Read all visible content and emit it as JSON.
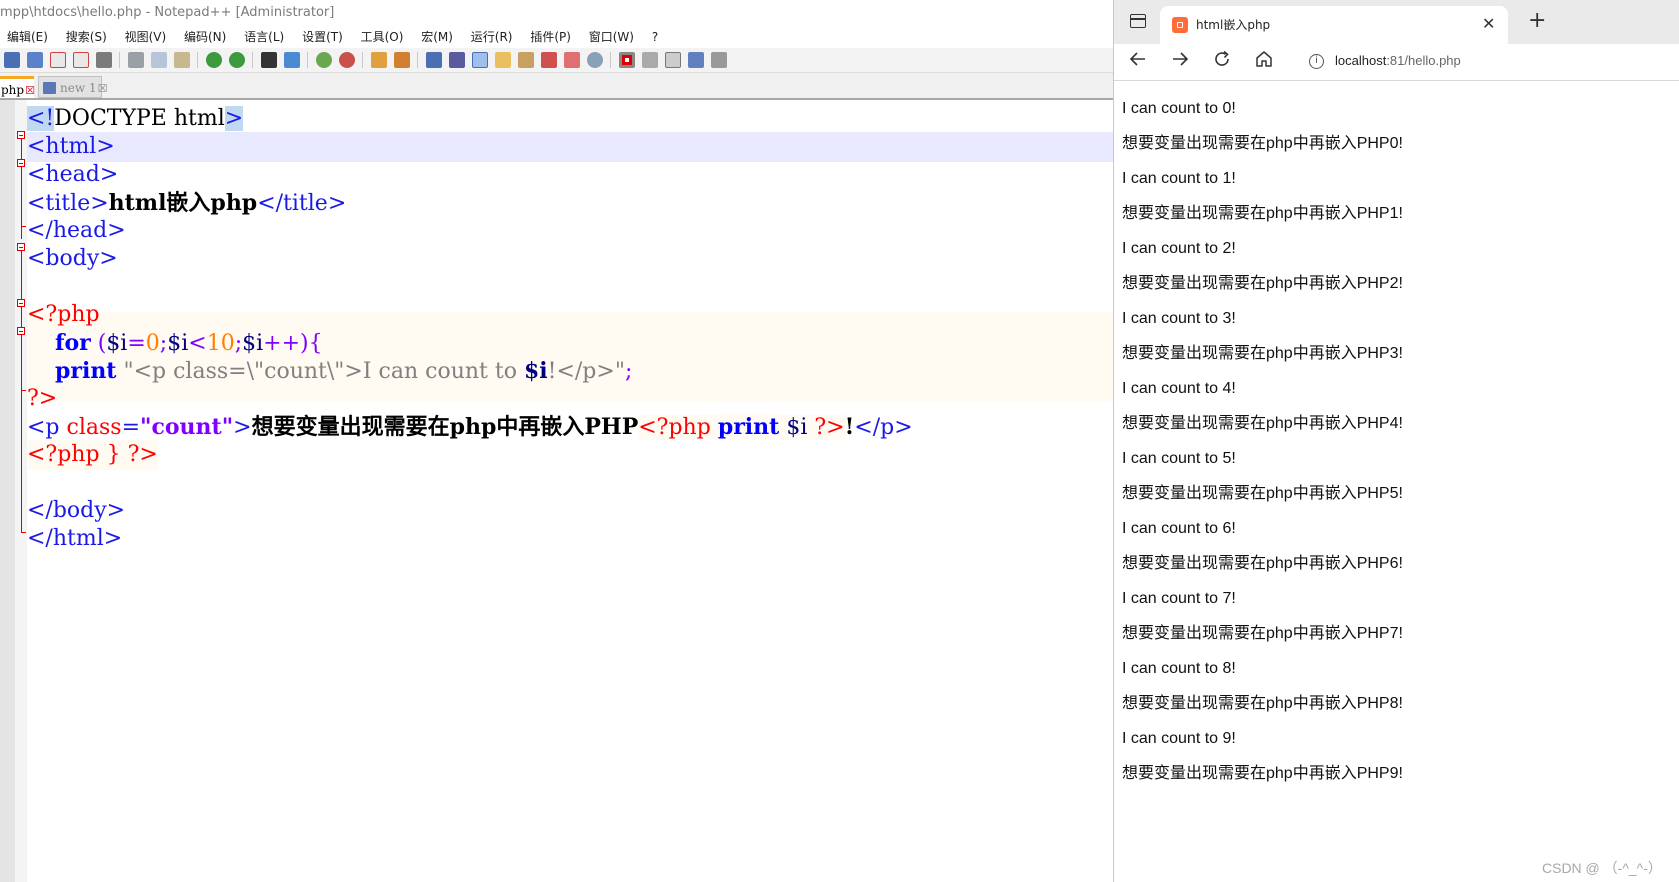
{
  "npp": {
    "title": "mpp\\htdocs\\hello.php - Notepad++ [Administrator]",
    "menu": [
      "编辑(E)",
      "搜索(S)",
      "视图(V)",
      "编码(N)",
      "语言(L)",
      "设置(T)",
      "工具(O)",
      "宏(M)",
      "运行(R)",
      "插件(P)",
      "窗口(W)",
      "?"
    ],
    "tabs": {
      "active": "php",
      "inactive": "new 1",
      "close_glyph": "☒"
    },
    "code": {
      "l1": {
        "open": "<!",
        "rest": "DOCTYPE html",
        "close": ">"
      },
      "l2": "<html>",
      "l3": "<head>",
      "l4": {
        "open": "<title>",
        "text": "html嵌入php",
        "close": "</title>"
      },
      "l5": "</head>",
      "l6": "<body>",
      "l8": "<?php",
      "l9": {
        "indent": "    ",
        "kw": "for",
        "space": " ",
        "p1": "(",
        "v1": "$i",
        "eq": "=",
        "n0": "0",
        "semi1": ";",
        "v2": "$i",
        "lt": "<",
        "n10": "10",
        "semi2": ";",
        "v3": "$i",
        "inc": "++)",
        "brace": "{"
      },
      "l10": {
        "indent": "    ",
        "kw": "print",
        "space": " ",
        "str": "\"<p class=\\\"count\\\">I can count to ",
        "var": "$i",
        "str2": "!</p>\"",
        "semi": ";"
      },
      "l11": "?>",
      "l12": {
        "t1": "<p ",
        "attr": "class",
        "eq": "=",
        "aval": "\"count\"",
        "t2": ">",
        "text": "想要变量出现需要在php中再嵌入PHP",
        "php_open": "<?php",
        "sp1": " ",
        "kw": "print",
        "sp2": " ",
        "var": "$i",
        "sp3": " ",
        "php_close": "?>",
        "bang": "!",
        "t3": "</p>"
      },
      "l13": {
        "open": "<?php",
        "brace": " } ",
        "close": "?>"
      },
      "l15": "</body>",
      "l16": "</html>"
    }
  },
  "browser": {
    "tab_title": "html嵌入php",
    "tab_close": "✕",
    "new_tab": "+",
    "url_host": "localhost",
    "url_path": ":81/hello.php",
    "info": "i",
    "lines": [
      "I can count to 0!",
      "想要变量出现需要在php中再嵌入PHP0!",
      "I can count to 1!",
      "想要变量出现需要在php中再嵌入PHP1!",
      "I can count to 2!",
      "想要变量出现需要在php中再嵌入PHP2!",
      "I can count to 3!",
      "想要变量出现需要在php中再嵌入PHP3!",
      "I can count to 4!",
      "想要变量出现需要在php中再嵌入PHP4!",
      "I can count to 5!",
      "想要变量出现需要在php中再嵌入PHP5!",
      "I can count to 6!",
      "想要变量出现需要在php中再嵌入PHP6!",
      "I can count to 7!",
      "想要变量出现需要在php中再嵌入PHP7!",
      "I can count to 8!",
      "想要变量出现需要在php中再嵌入PHP8!",
      "I can count to 9!",
      "想要变量出现需要在php中再嵌入PHP9!"
    ]
  },
  "watermark": "CSDN @ （-^_^-）",
  "icons": {
    "back": "arrow-left-icon",
    "forward": "arrow-right-icon",
    "reload": "reload-icon",
    "home": "home-icon"
  }
}
